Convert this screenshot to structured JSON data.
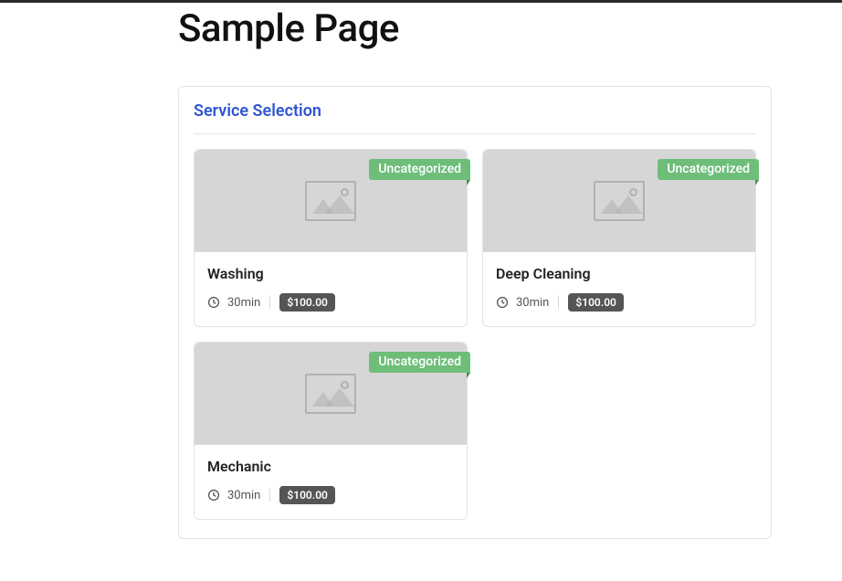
{
  "page": {
    "title": "Sample Page"
  },
  "panel": {
    "title": "Service Selection"
  },
  "services": [
    {
      "name": "Washing",
      "category": "Uncategorized",
      "duration": "30min",
      "price": "$100.00"
    },
    {
      "name": "Deep Cleaning",
      "category": "Uncategorized",
      "duration": "30min",
      "price": "$100.00"
    },
    {
      "name": "Mechanic",
      "category": "Uncategorized",
      "duration": "30min",
      "price": "$100.00"
    }
  ]
}
